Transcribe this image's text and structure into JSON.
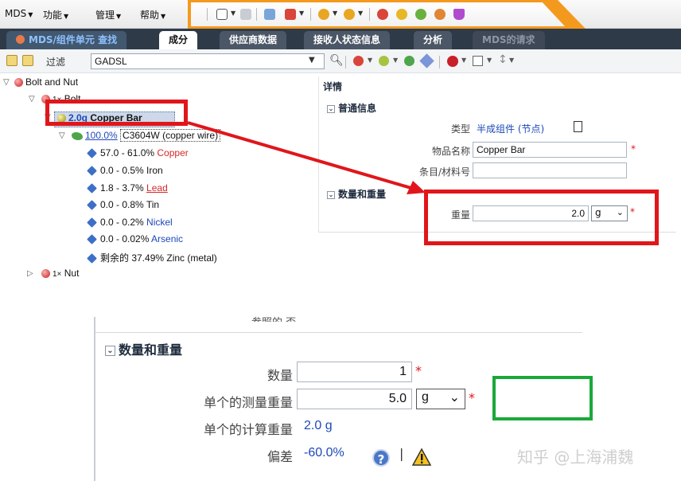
{
  "menubar": {
    "items": [
      "MDS",
      "功能",
      "管理",
      "帮助"
    ]
  },
  "tabs": [
    {
      "label": "MDS/组件单元 查找"
    },
    {
      "label": "成分"
    },
    {
      "label": "供应商数据"
    },
    {
      "label": "接收人状态信息"
    },
    {
      "label": "分析"
    },
    {
      "label": "MDS的请求"
    }
  ],
  "filter": {
    "label": "过滤",
    "value": "GADSL"
  },
  "tree": {
    "root": "Bolt and Nut",
    "bolt": {
      "qty": "1×",
      "name": "Bolt"
    },
    "copper_bar": {
      "qty": "2.0g",
      "name": "Copper Bar"
    },
    "material": {
      "pct": "100.0%",
      "name": "C3604W (copper wire)"
    },
    "substances": [
      {
        "range": "57.0 - 61.0%",
        "name": "Copper"
      },
      {
        "range": "0.0 - 0.5%",
        "name": "Iron"
      },
      {
        "range": "1.8 - 3.7%",
        "name": "Lead"
      },
      {
        "range": "0.0 - 0.8%",
        "name": "Tin"
      },
      {
        "range": "0.0 - 0.2%",
        "name": "Nickel"
      },
      {
        "range": "0.0 - 0.02%",
        "name": "Arsenic"
      },
      {
        "range": "剩余的 37.49%",
        "name": "Zinc (metal)"
      }
    ],
    "nut": {
      "qty": "1×",
      "name": "Nut"
    }
  },
  "detail": {
    "title": "详情",
    "general_section": "普通信息",
    "type_label": "类型",
    "type_value": "半成组件 (节点)",
    "name_label": "物品名称",
    "name_value": "Copper Bar",
    "item_label": "条目/材料号",
    "item_value": "",
    "qw_section": "数量和重量",
    "weight_label": "重量",
    "weight_value": "2.0",
    "weight_unit": "g",
    "required_mark": "*"
  },
  "bottom": {
    "cut_text": "参照的 否",
    "section": "数量和重量",
    "qty_label": "数量",
    "qty_value": "1",
    "measured_label": "单个的测量重量",
    "measured_value": "5.0",
    "measured_unit": "g",
    "calc_label": "单个的计算重量",
    "calc_value": "2.0 g",
    "dev_label": "偏差",
    "dev_value": "-60.0%",
    "separator": "|",
    "required_mark": "*"
  },
  "watermark": "知乎 @上海浦魏",
  "colors": {
    "highlight_red": "#e0161b",
    "highlight_green": "#1aa83a",
    "accent_orange": "#f39a1e",
    "tabbar_dark": "#2f3a48",
    "link_blue": "#1d49b9"
  }
}
